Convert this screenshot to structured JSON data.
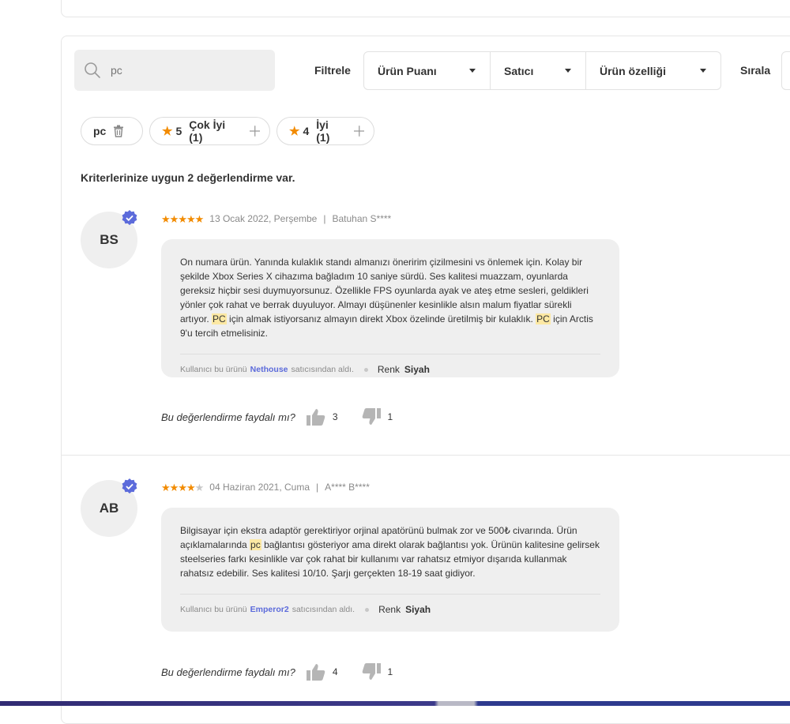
{
  "search": {
    "value": "",
    "placeholder": "pc"
  },
  "filters": {
    "label": "Filtrele",
    "dropdowns": [
      "Ürün Puanı",
      "Satıcı",
      "Ürün özelliği"
    ]
  },
  "sort": {
    "label": "Sırala"
  },
  "chips": [
    {
      "label": "pc"
    },
    {
      "stars": "5",
      "label": "Çok İyi (1)"
    },
    {
      "stars": "4",
      "label": "İyi (1)"
    }
  ],
  "result_count": "Kriterlerinize uygun 2 değerlendirme var.",
  "reviews": [
    {
      "initials": "BS",
      "rating": 5,
      "date": "13 Ocak 2022, Perşembe",
      "author": "Batuhan S****",
      "text_parts": [
        "On numara ürün. Yanında kulaklık standı almanızı öneririm çizilmesini vs önlemek için. Kolay bir şekilde Xbox Series X cihazıma bağladım 10 saniye sürdü. Ses kalitesi muazzam, oyunlarda gereksiz hiçbir sesi duymuyorsunuz. Özellikle FPS oyunlarda ayak ve ateş etme sesleri, geldikleri yönler çok rahat ve berrak duyuluyor. Almayı düşünenler kesinlikle alsın malum fiyatlar sürekli artıyor. ",
        "PC",
        " için almak istiyorsanız almayın direkt Xbox özelinde üretilmiş bir kulaklık. ",
        "PC",
        " için Arctis 9'u tercih etmelisiniz."
      ],
      "seller_prefix": "Kullanıcı bu ürünü",
      "seller": "Nethouse",
      "seller_suffix": "satıcısından aldı.",
      "color_label": "Renk",
      "color_value": "Siyah",
      "helpful_question": "Bu değerlendirme faydalı mı?",
      "likes": "3",
      "dislikes": "1"
    },
    {
      "initials": "AB",
      "rating": 4,
      "date": "04 Haziran 2021, Cuma",
      "author": "A**** B****",
      "text_parts": [
        "Bilgisayar için ekstra adaptör gerektiriyor orjinal apatörünü bulmak zor ve 500₺ civarında. Ürün açıklamalarında ",
        "pc",
        " bağlantısı gösteriyor ama direkt olarak bağlantısı yok. Ürünün kalitesine gelirsek steelseries farkı kesinlikle var çok rahat bir kullanımı var rahatsız etmiyor dışarıda kullanmak rahatsız edebilir. Ses kalitesi 10/10. Şarjı gerçekten 18-19 saat gidiyor.",
        "",
        ""
      ],
      "seller_prefix": "Kullanıcı bu ürünü",
      "seller": "Emperor2",
      "seller_suffix": "satıcısından aldı.",
      "color_label": "Renk",
      "color_value": "Siyah",
      "helpful_question": "Bu değerlendirme faydalı mı?",
      "likes": "4",
      "dislikes": "1"
    }
  ],
  "colors": {
    "star": "#f28b00",
    "highlight": "#fce8a3",
    "link": "#5c6bdb",
    "verified": "#5c6bdb"
  }
}
